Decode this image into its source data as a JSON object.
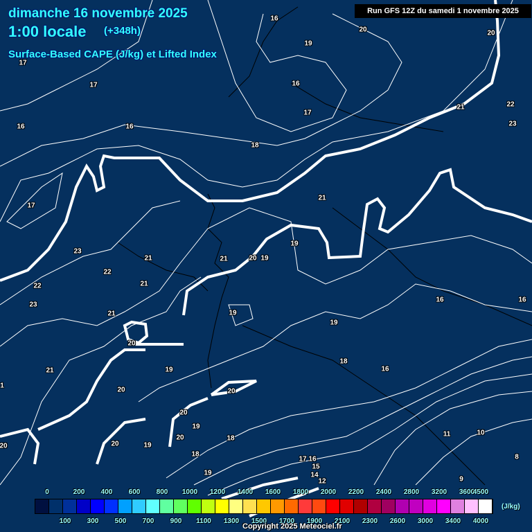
{
  "header": {
    "date": "dimanche 16 novembre 2025",
    "time": "1:00 locale",
    "lead": "(+348h)",
    "parameter": "Surface-Based CAPE (J/kg) et Lifted Index",
    "run": "Run GFS 12Z du samedi 1 novembre 2025"
  },
  "contour_labels": [
    "16",
    "20",
    "20",
    "19",
    "17",
    "16",
    "21",
    "22",
    "23",
    "16",
    "16",
    "17",
    "18",
    "17",
    "21",
    "19",
    "23",
    "21",
    "21",
    "20",
    "19",
    "22",
    "21",
    "22",
    "23",
    "16",
    "16",
    "21",
    "19",
    "19",
    "20",
    "18",
    "21",
    "19",
    "16",
    "20",
    "20",
    "20",
    "19",
    "20",
    "18",
    "11",
    "10",
    "20",
    "19",
    "18",
    "8",
    "17",
    "16",
    "15",
    "14",
    "12",
    "19",
    "9",
    "20",
    "17",
    "1"
  ],
  "legend": {
    "unit": "(J/kg)",
    "top_ticks": [
      "0",
      "200",
      "400",
      "600",
      "800",
      "1000",
      "1200",
      "1400",
      "1600",
      "1800",
      "2000",
      "2200",
      "2400",
      "2800",
      "3200",
      "3600",
      "4500"
    ],
    "bottom_ticks": [
      "100",
      "300",
      "500",
      "700",
      "900",
      "1100",
      "1300",
      "1500",
      "1700",
      "1900",
      "2100",
      "2300",
      "2600",
      "3000",
      "3400",
      "4000"
    ],
    "colors": [
      "#001040",
      "#00306a",
      "#00309a",
      "#0000c8",
      "#0000ff",
      "#0030ff",
      "#00a0ff",
      "#30ccff",
      "#60ffff",
      "#60ffa0",
      "#60ff60",
      "#60ff00",
      "#c0ff10",
      "#ffff00",
      "#ffff80",
      "#ffe050",
      "#ffc800",
      "#ff9a00",
      "#ff6a00",
      "#ff3a3a",
      "#ff4a10",
      "#ff0000",
      "#e00000",
      "#b00000",
      "#b00040",
      "#a00060",
      "#b000b0",
      "#c000c0",
      "#e000e0",
      "#ff00ff",
      "#e080e0",
      "#ffc0ff",
      "#ffffff"
    ]
  },
  "copyright": "Copyright 2025 Meteociel.fr"
}
